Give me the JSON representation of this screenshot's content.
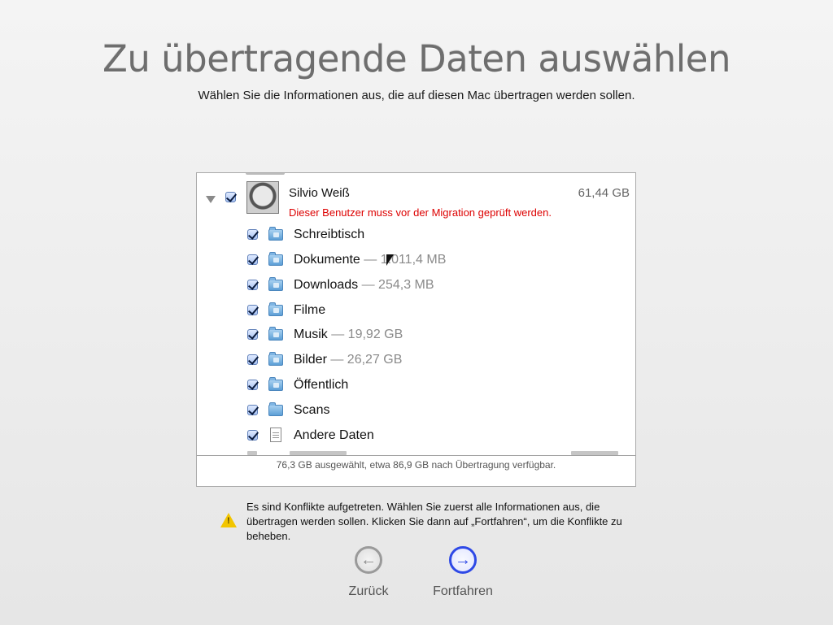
{
  "page": {
    "title": "Zu übertragende Daten auswählen",
    "subtitle": "Wählen Sie die Informationen aus, die auf diesen Mac übertragen werden sollen."
  },
  "user": {
    "name": "Silvio Weiß",
    "size": "61,44 GB",
    "warning": "Dieser Benutzer muss vor der Migration geprüft werden.",
    "checked": true,
    "expanded": true
  },
  "items": [
    {
      "label": "Schreibtisch",
      "size": "",
      "icon": "desktop-folder-icon",
      "checked": true
    },
    {
      "label": "Dokumente",
      "size": " — 1.011,4 MB",
      "icon": "documents-folder-icon",
      "checked": true
    },
    {
      "label": "Downloads",
      "size": " — 254,3 MB",
      "icon": "downloads-folder-icon",
      "checked": true
    },
    {
      "label": "Filme",
      "size": "",
      "icon": "movies-folder-icon",
      "checked": true
    },
    {
      "label": "Musik",
      "size": " — 19,92 GB",
      "icon": "music-folder-icon",
      "checked": true
    },
    {
      "label": "Bilder",
      "size": " — 26,27 GB",
      "icon": "pictures-folder-icon",
      "checked": true
    },
    {
      "label": "Öffentlich",
      "size": "",
      "icon": "public-folder-icon",
      "checked": true
    },
    {
      "label": "Scans",
      "size": "",
      "icon": "folder-icon",
      "checked": true
    },
    {
      "label": "Andere Daten",
      "size": "",
      "icon": "document-icon",
      "checked": true
    }
  ],
  "summary": "76,3 GB ausgewählt, etwa 86,9 GB nach Übertragung verfügbar.",
  "conflict": {
    "icon": "warning-icon",
    "text": "Es sind Konflikte aufgetreten. Wählen Sie zuerst alle Informationen aus, die übertragen werden sollen. Klicken Sie dann auf „Fortfahren“, um die Konflikte zu beheben."
  },
  "buttons": {
    "back": "Zurück",
    "continue": "Fortfahren"
  },
  "colors": {
    "warning_text": "#dd0000",
    "continue_accent": "#2e49e6"
  }
}
